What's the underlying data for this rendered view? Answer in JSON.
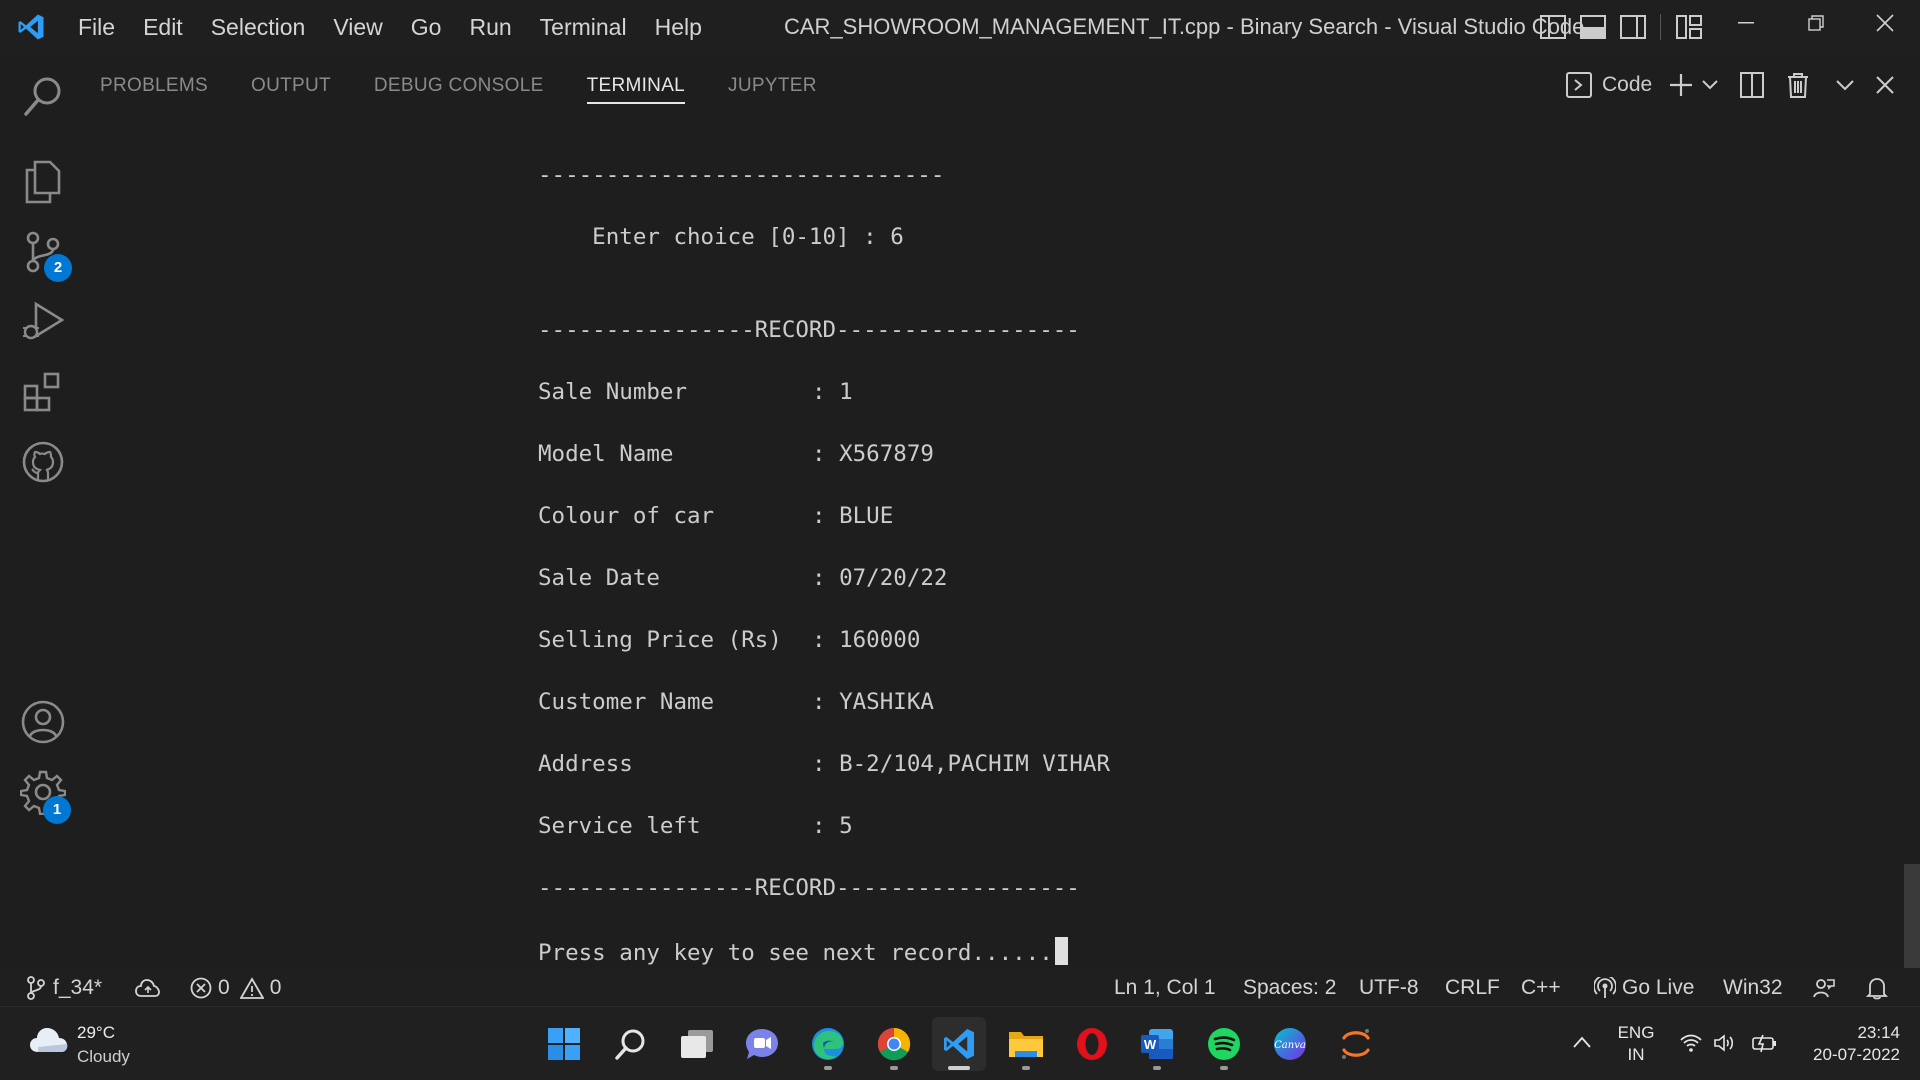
{
  "titlebar": {
    "menu": [
      "File",
      "Edit",
      "Selection",
      "View",
      "Go",
      "Run",
      "Terminal",
      "Help"
    ],
    "title": "CAR_SHOWROOM_MANAGEMENT_IT.cpp - Binary Search - Visual Studio Code"
  },
  "activitybar": {
    "scm_badge": "2",
    "settings_badge": "1"
  },
  "panel": {
    "tabs": [
      "PROBLEMS",
      "OUTPUT",
      "DEBUG CONSOLE",
      "TERMINAL",
      "JUPYTER"
    ],
    "active_tab": "TERMINAL",
    "terminal_name": "Code"
  },
  "terminal": {
    "separator_top": "------------------------------",
    "prompt": "    Enter choice [0-10] : 6",
    "record_header": "----------------RECORD------------------",
    "fields": [
      {
        "label": "Sale Number",
        "value": "1"
      },
      {
        "label": "Model Name",
        "value": "X567879"
      },
      {
        "label": "Colour of car",
        "value": "BLUE"
      },
      {
        "label": "Sale Date",
        "value": "07/20/22"
      },
      {
        "label": "Selling Price (Rs)",
        "value": "160000"
      },
      {
        "label": "Customer Name",
        "value": "YASHIKA"
      },
      {
        "label": "Address",
        "value": "B-2/104,PACHIM VIHAR"
      },
      {
        "label": "Service left",
        "value": "5"
      }
    ],
    "record_footer": "----------------RECORD------------------",
    "continue_prompt": "Press any key to see next record......"
  },
  "statusbar": {
    "branch": "f_34*",
    "errors": "0",
    "warnings": "0",
    "position": "Ln 1, Col 1",
    "spaces": "Spaces: 2",
    "encoding": "UTF-8",
    "eol": "CRLF",
    "language": "C++",
    "go_live": "Go Live",
    "platform": "Win32"
  },
  "taskbar": {
    "weather_temp": "29°C",
    "weather_desc": "Cloudy",
    "lang_top": "ENG",
    "lang_bottom": "IN",
    "time": "23:14",
    "date": "20-07-2022",
    "colors": {
      "accent": "#0078d4",
      "vscode_blue": "#2f9df4"
    }
  }
}
